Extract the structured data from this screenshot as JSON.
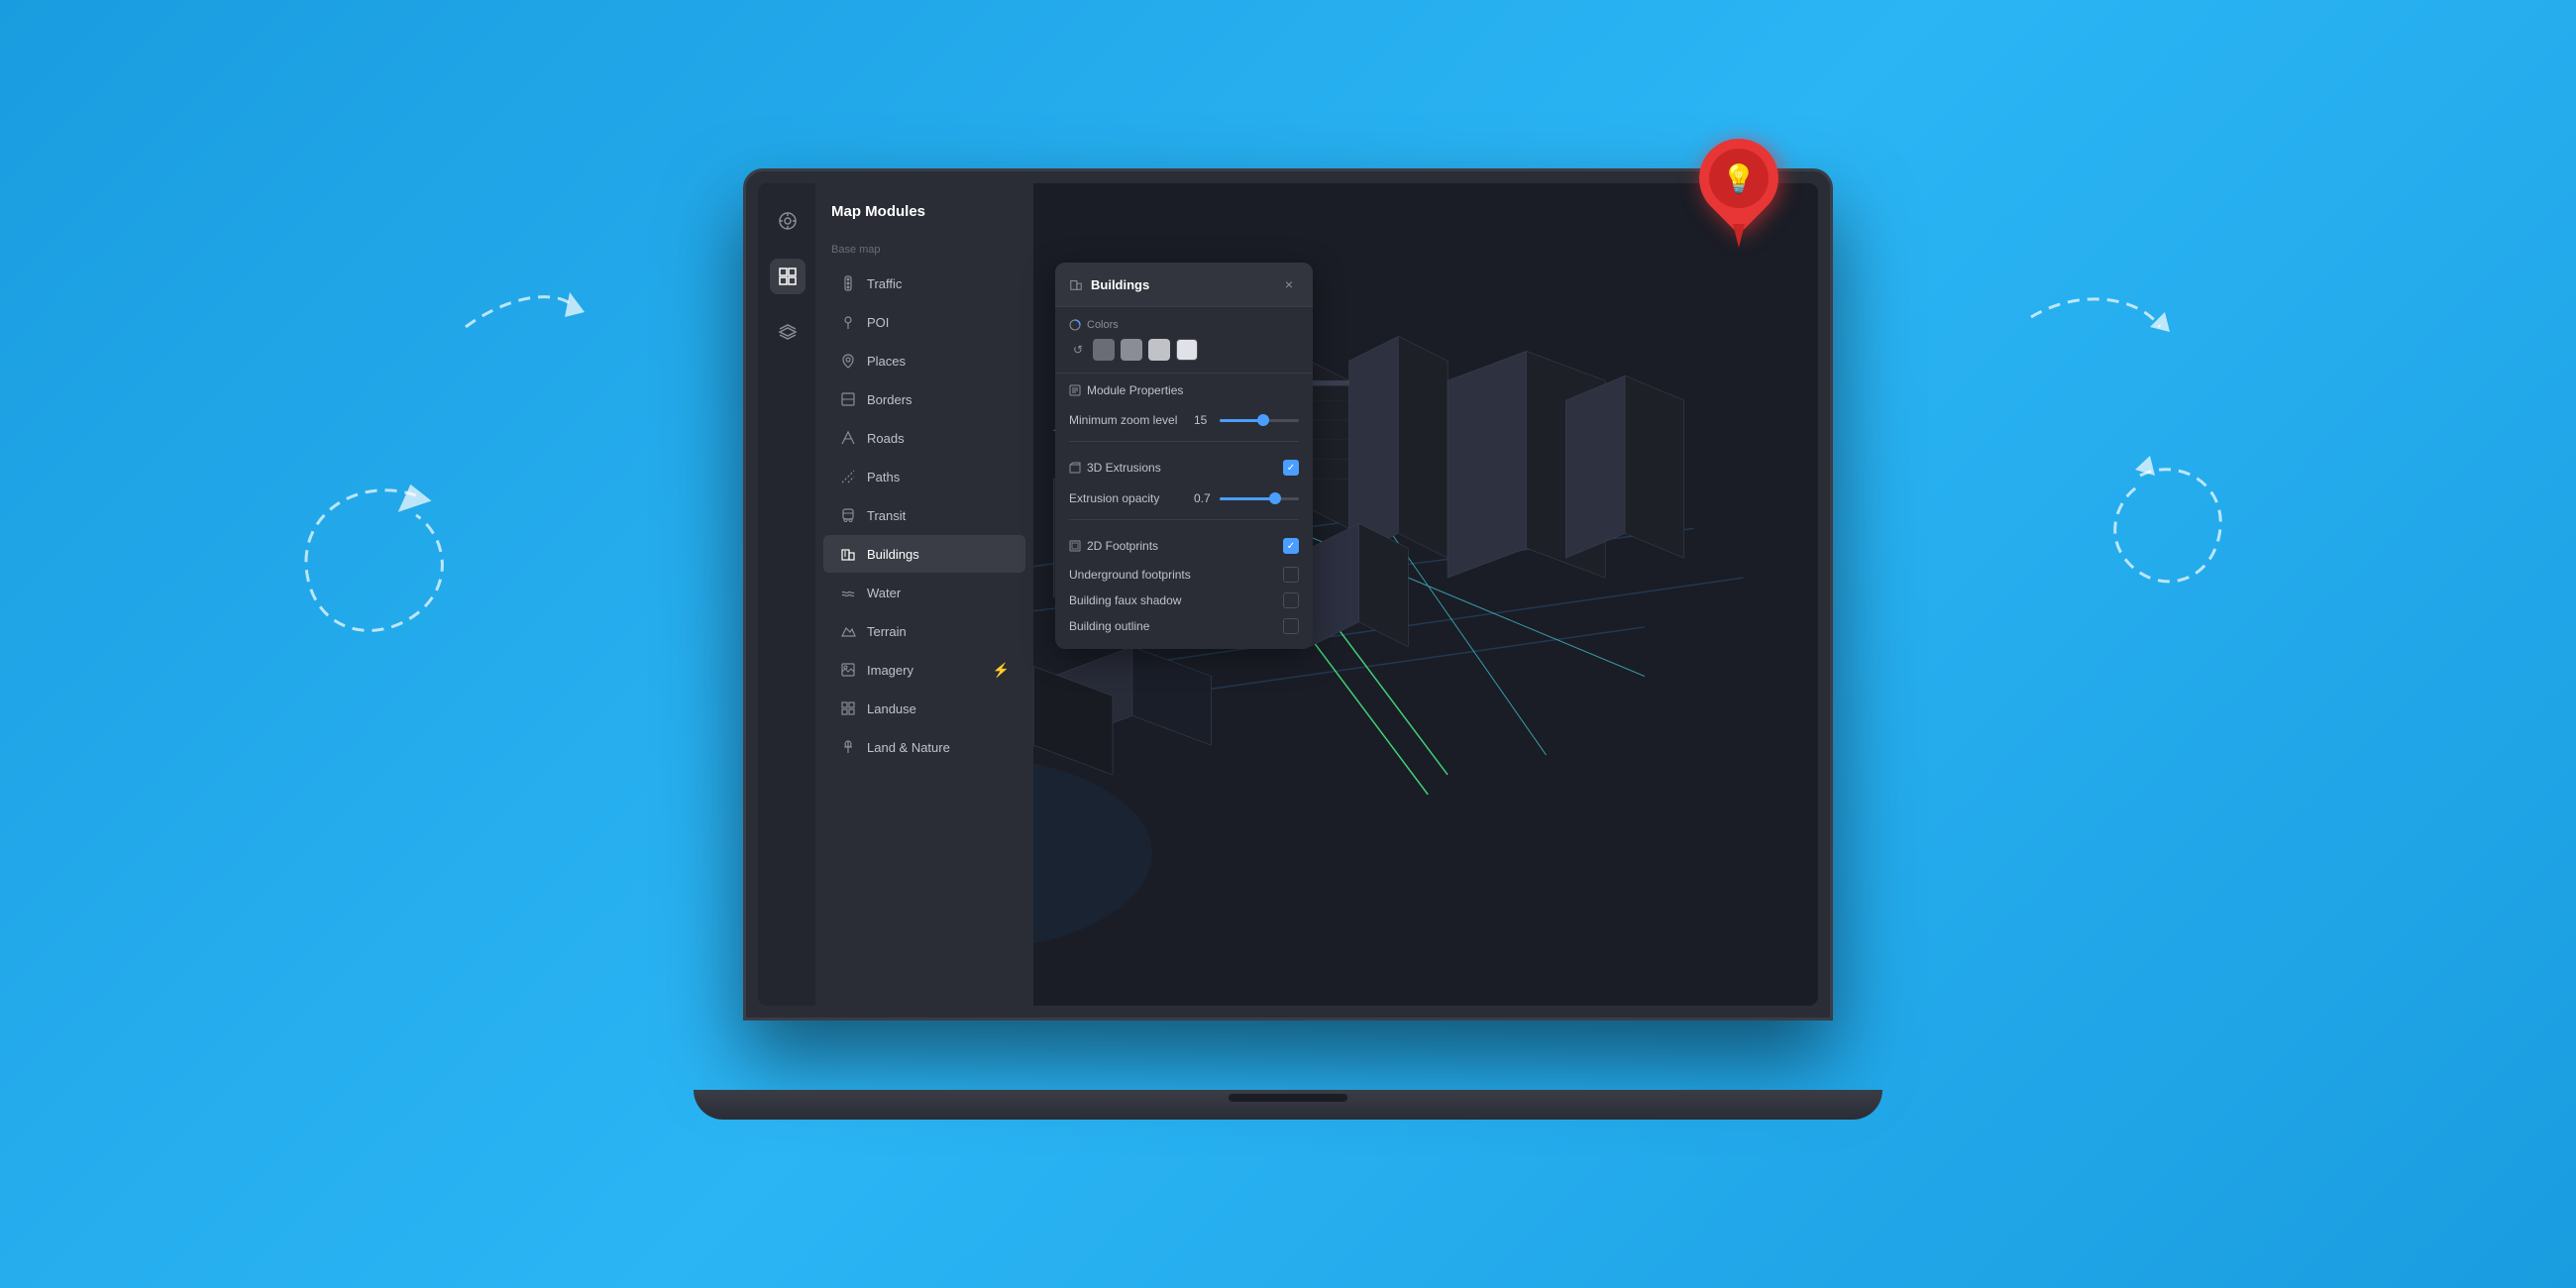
{
  "background_color": "#29aaef",
  "app_title": "Map Modules",
  "sidebar": {
    "icons": [
      {
        "name": "target-icon",
        "symbol": "◎",
        "active": false
      },
      {
        "name": "grid-icon",
        "symbol": "⊞",
        "active": true
      },
      {
        "name": "layers-icon",
        "symbol": "≡",
        "active": false
      }
    ]
  },
  "modules_panel": {
    "title": "Map Modules",
    "section_label": "Base map",
    "items": [
      {
        "label": "Traffic",
        "icon": "traffic-icon",
        "active": false
      },
      {
        "label": "POI",
        "icon": "poi-icon",
        "active": false
      },
      {
        "label": "Places",
        "icon": "places-icon",
        "active": false
      },
      {
        "label": "Borders",
        "icon": "borders-icon",
        "active": false
      },
      {
        "label": "Roads",
        "icon": "roads-icon",
        "active": false
      },
      {
        "label": "Paths",
        "icon": "paths-icon",
        "active": false
      },
      {
        "label": "Transit",
        "icon": "transit-icon",
        "active": false
      },
      {
        "label": "Buildings",
        "icon": "buildings-icon",
        "active": true
      },
      {
        "label": "Water",
        "icon": "water-icon",
        "active": false
      },
      {
        "label": "Terrain",
        "icon": "terrain-icon",
        "active": false
      },
      {
        "label": "Imagery",
        "icon": "imagery-icon",
        "active": false
      },
      {
        "label": "Landuse",
        "icon": "landuse-icon",
        "active": false
      },
      {
        "label": "Land & Nature",
        "icon": "land-nature-icon",
        "active": false
      }
    ]
  },
  "buildings_panel": {
    "title": "Buildings",
    "close_label": "×",
    "colors_section": {
      "label": "Colors",
      "swatches": [
        "#6a6d75",
        "#8a8d95",
        "#c0c2c8",
        "#e8e8e8"
      ]
    },
    "module_properties": {
      "label": "Module Properties",
      "zoom_level": {
        "label": "Minimum zoom level",
        "value": "15",
        "fill_percent": 55
      }
    },
    "extrusions": {
      "label": "3D Extrusions",
      "checked": true,
      "opacity": {
        "label": "Extrusion opacity",
        "value": "0.7",
        "fill_percent": 70
      }
    },
    "footprints": {
      "label": "2D Footprints",
      "checked": true,
      "items": [
        {
          "label": "Underground footprints",
          "checked": false
        },
        {
          "label": "Building faux shadow",
          "checked": false
        },
        {
          "label": "Building outline",
          "checked": false
        }
      ]
    }
  },
  "pin": {
    "color": "#e83535",
    "icon": "💡"
  }
}
